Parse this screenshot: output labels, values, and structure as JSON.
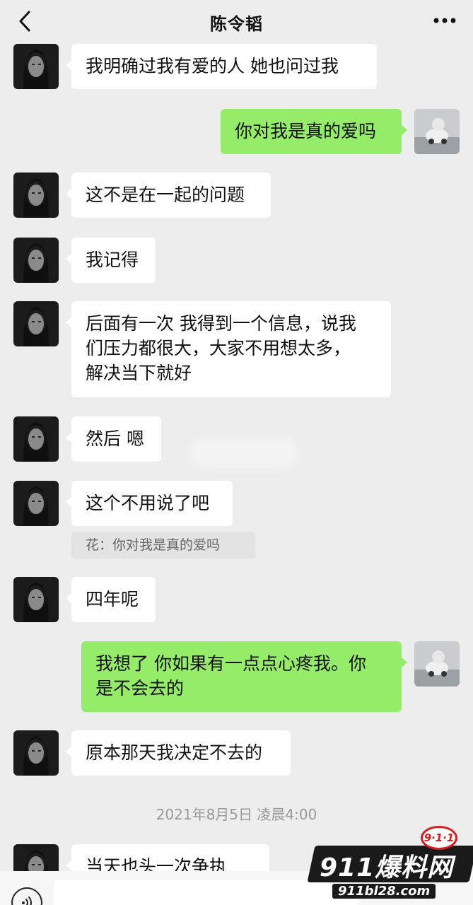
{
  "header": {
    "title": "陈令韬"
  },
  "messages": [
    {
      "side": "left",
      "text": "我明确过我有爱的人 她也问过我"
    },
    {
      "side": "right",
      "text": "你对我是真的爱吗"
    },
    {
      "side": "left",
      "text": "这不是在一起的问题"
    },
    {
      "side": "left",
      "text": "我记得"
    },
    {
      "side": "left",
      "lines": [
        "后面有一次 我得到一个信息，说我",
        "们压力都很大，大家不用想太多，",
        "解决当下就好"
      ]
    },
    {
      "side": "left",
      "text": "然后 嗯"
    },
    {
      "side": "left",
      "text": "这个不用说了吧"
    },
    {
      "side": "left",
      "text": "四年呢"
    },
    {
      "side": "right",
      "lines": [
        "我想了 你如果有一点点心疼我。你",
        "是不会去的"
      ]
    },
    {
      "side": "left",
      "text": "原本那天我决定不去的"
    },
    {
      "side": "left",
      "text": "当天也头一次争执"
    }
  ],
  "quote": {
    "text": "花：你对我是真的爱吗"
  },
  "timestamp": "2021年8月5日 凌晨4:00",
  "watermark": {
    "main": "911爆料网",
    "url": "911bl28.com",
    "badge": "9·1·1"
  },
  "icons": {
    "back": "chevron-left-icon",
    "more": "more-dots-icon",
    "voice": "voice-icon"
  }
}
